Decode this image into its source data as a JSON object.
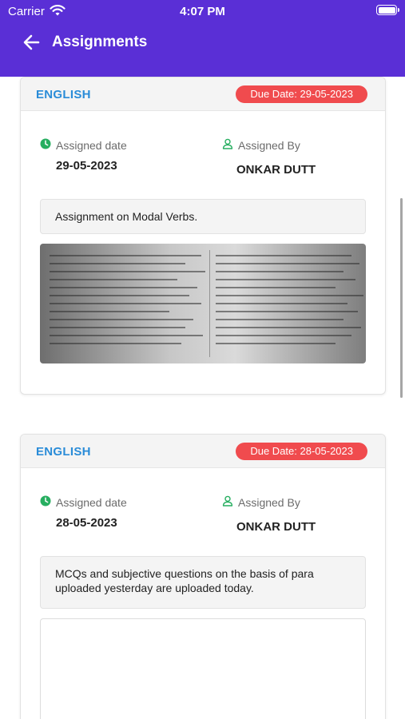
{
  "status_bar": {
    "carrier": "Carrier",
    "time": "4:07 PM"
  },
  "header": {
    "title": "Assignments"
  },
  "assignments": [
    {
      "subject": "ENGLISH",
      "due_date": "Due Date: 29-05-2023",
      "assigned_date_label": "Assigned date",
      "assigned_date": "29-05-2023",
      "assigned_by_label": "Assigned By",
      "assigned_by": "ONKAR DUTT",
      "description": "Assignment on Modal Verbs."
    },
    {
      "subject": "ENGLISH",
      "due_date": "Due Date: 28-05-2023",
      "assigned_date_label": "Assigned date",
      "assigned_date": "28-05-2023",
      "assigned_by_label": "Assigned By",
      "assigned_by": "ONKAR DUTT",
      "description": "MCQs and subjective questions on the basis of para uploaded yesterday are uploaded today."
    }
  ],
  "colors": {
    "header_bg": "#5a2fd6",
    "subject": "#2a8cd8",
    "due_badge": "#f04b4e",
    "calendar_icon": "#27ae60",
    "person_icon": "#27ae60"
  },
  "icons": [
    "back-arrow-icon",
    "wifi-icon",
    "battery-icon",
    "clock-icon",
    "person-icon"
  ]
}
